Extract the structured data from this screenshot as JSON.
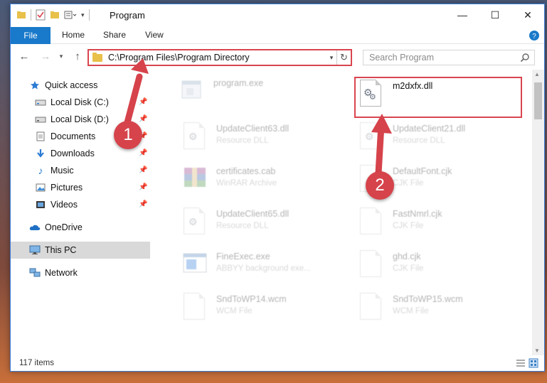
{
  "window": {
    "title": "Program",
    "controls": {
      "minimize": "—",
      "maximize": "☐",
      "close": "✕"
    }
  },
  "ribbon": {
    "tabs": [
      "File",
      "Home",
      "Share",
      "View"
    ]
  },
  "nav": {
    "address_path": "C:\\Program Files\\Program Directory",
    "search_placeholder": "Search Program"
  },
  "sidebar": {
    "items": [
      {
        "label": "Quick access",
        "icon": "star-icon",
        "pinned": false,
        "selected": false
      },
      {
        "label": "Local Disk (C:)",
        "icon": "drive-icon",
        "pinned": true,
        "selected": false
      },
      {
        "label": "Local Disk (D:)",
        "icon": "drive-icon",
        "pinned": true,
        "selected": false
      },
      {
        "label": "Documents",
        "icon": "documents-icon",
        "pinned": true,
        "selected": false
      },
      {
        "label": "Downloads",
        "icon": "downloads-icon",
        "pinned": true,
        "selected": false
      },
      {
        "label": "Music",
        "icon": "music-icon",
        "pinned": true,
        "selected": false
      },
      {
        "label": "Pictures",
        "icon": "pictures-icon",
        "pinned": true,
        "selected": false
      },
      {
        "label": "Videos",
        "icon": "videos-icon",
        "pinned": true,
        "selected": false
      },
      {
        "label": "OneDrive",
        "icon": "cloud-icon",
        "pinned": false,
        "selected": false
      },
      {
        "label": "This PC",
        "icon": "monitor-icon",
        "pinned": false,
        "selected": true
      },
      {
        "label": "Network",
        "icon": "network-icon",
        "pinned": false,
        "selected": false
      }
    ]
  },
  "files": [
    {
      "name": "program.exe",
      "type": "",
      "icon": "exe-icon",
      "highlighted": false
    },
    {
      "name": "m2dxfx.dll",
      "type": "",
      "icon": "dll-gear-icon",
      "highlighted": true
    },
    {
      "name": "UpdateClient63.dll",
      "type": "Resource DLL",
      "icon": "dll-gear-icon",
      "highlighted": false
    },
    {
      "name": "UpdateClient21.dll",
      "type": "Resource DLL",
      "icon": "dll-gear-icon",
      "highlighted": false
    },
    {
      "name": "certificates.cab",
      "type": "WinRAR Archive",
      "icon": "winrar-icon",
      "highlighted": false
    },
    {
      "name": "DefaultFont.cjk",
      "type": "CJK File",
      "icon": "blank-file-icon",
      "highlighted": false
    },
    {
      "name": "UpdateClient65.dll",
      "type": "Resource DLL",
      "icon": "dll-gear-icon",
      "highlighted": false
    },
    {
      "name": "FastNmrl.cjk",
      "type": "CJK File",
      "icon": "blank-file-icon",
      "highlighted": false
    },
    {
      "name": "FineExec.exe",
      "type": "ABBYY background exe...",
      "icon": "exe-window-icon",
      "highlighted": false
    },
    {
      "name": "ghd.cjk",
      "type": "CJK File",
      "icon": "blank-file-icon",
      "highlighted": false
    },
    {
      "name": "SndToWP14.wcm",
      "type": "WCM File",
      "icon": "blank-file-icon",
      "highlighted": false
    },
    {
      "name": "SndToWP15.wcm",
      "type": "WCM File",
      "icon": "blank-file-icon",
      "highlighted": false
    }
  ],
  "status": {
    "item_count": "117 items"
  },
  "annotations": {
    "step1": "1",
    "step2": "2",
    "accent": "#d6434b"
  }
}
